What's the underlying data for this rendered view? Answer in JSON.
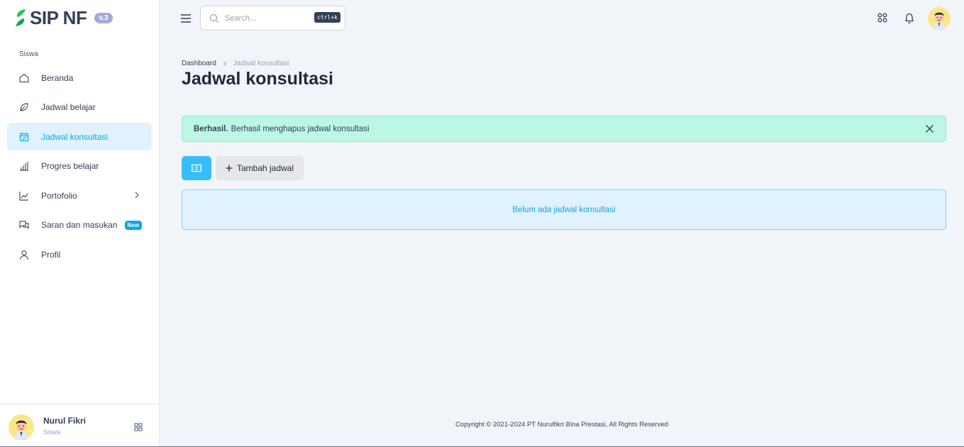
{
  "brand": {
    "name": "SIP NF",
    "version": "v.3",
    "accent": "#0ea5e9",
    "logo_color": "#22c55e"
  },
  "sidebar": {
    "section_label": "Siswa",
    "items": [
      {
        "label": "Beranda",
        "icon": "home-icon"
      },
      {
        "label": "Jadwal belajar",
        "icon": "leaf-icon"
      },
      {
        "label": "Jadwal konsultasi",
        "icon": "calendar-check-icon",
        "active": true
      },
      {
        "label": "Progres belajar",
        "icon": "bar-chart-icon"
      },
      {
        "label": "Portofolio",
        "icon": "line-chart-icon",
        "has_submenu": true
      },
      {
        "label": "Saran dan masukan",
        "icon": "chat-bubbles-icon",
        "badge": "New"
      },
      {
        "label": "Profil",
        "icon": "user-icon"
      }
    ],
    "user": {
      "name": "Nurul Fikri",
      "role": "Siswa"
    }
  },
  "header": {
    "search_placeholder": "Search...",
    "search_shortcut": "ctrl+k"
  },
  "breadcrumb": {
    "root": "Dashboard",
    "current": "Jadwal konsultasi"
  },
  "page": {
    "title": "Jadwal konsultasi",
    "alert": {
      "strong": "Berhasil.",
      "message": "Berhasil menghapus jadwal konsultasi"
    },
    "add_button": "Tambah jadwal",
    "empty_message": "Belum ada jadwal konsultasi"
  },
  "footer": {
    "copyright": "Copyright © 2021-2024 PT Nurulfikri Bina Prestasi, All Rights Reserved"
  }
}
